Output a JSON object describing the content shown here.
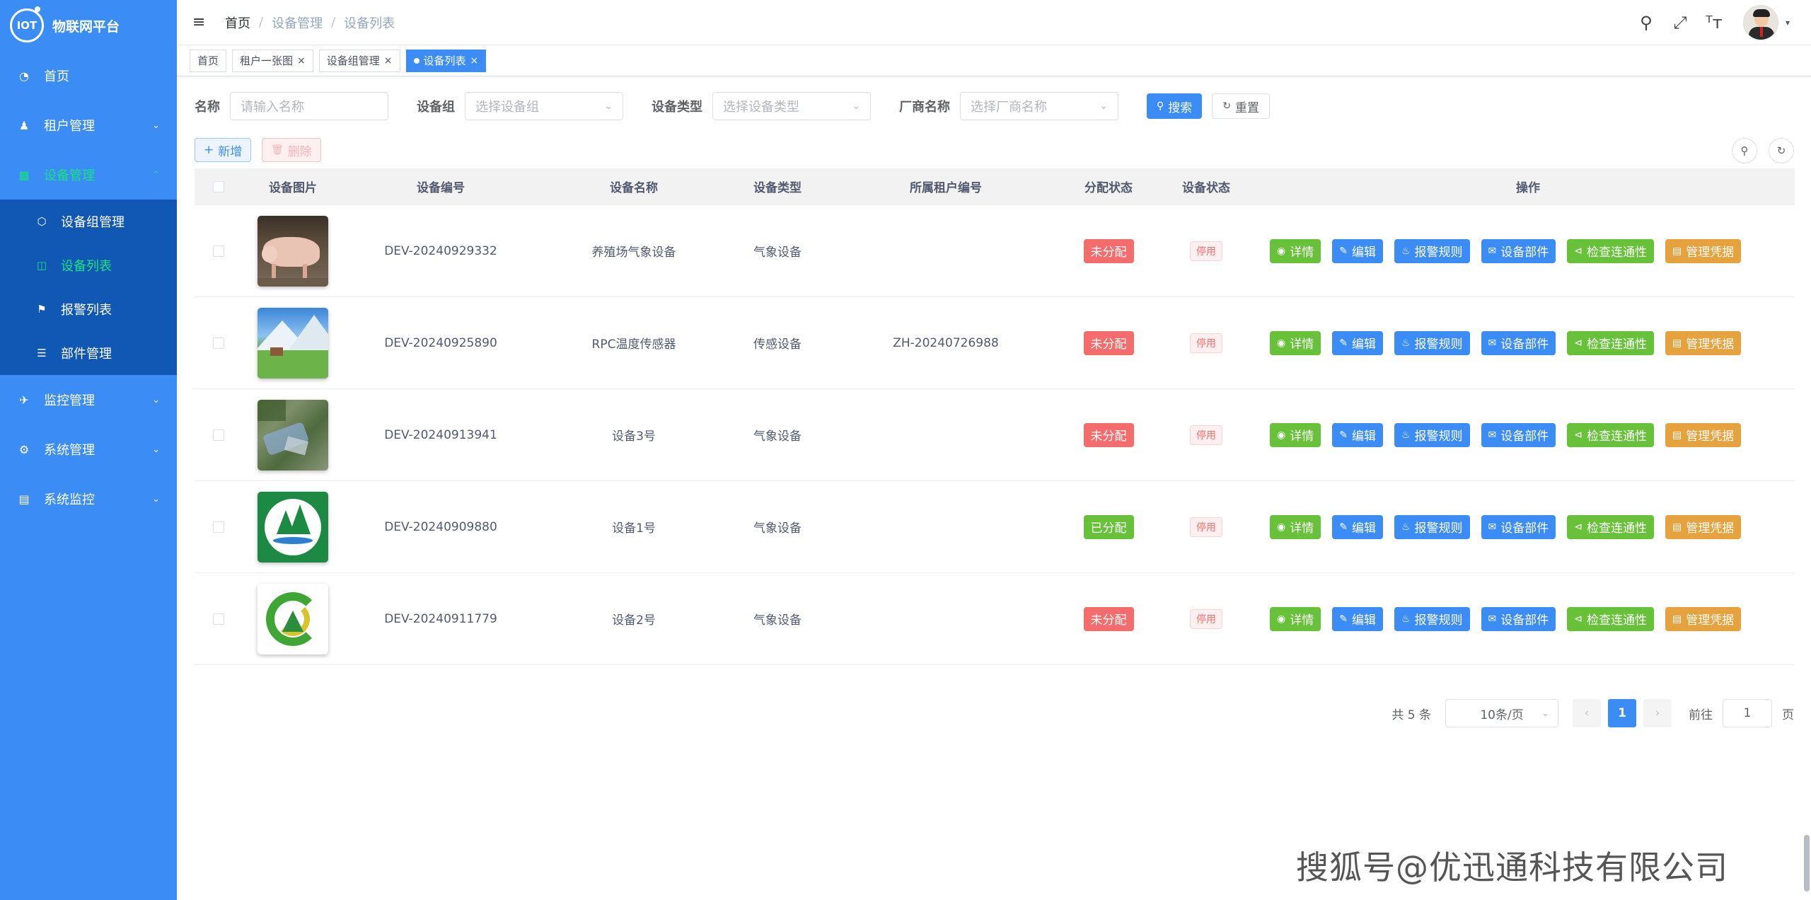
{
  "app": {
    "logo_text": "IOT",
    "title": "物联网平台"
  },
  "sidebar": {
    "items": [
      {
        "label": "首页",
        "icon": "dashboard-icon"
      },
      {
        "label": "租户管理",
        "icon": "user-icon"
      },
      {
        "label": "设备管理",
        "icon": "device-icon"
      },
      {
        "label": "监控管理",
        "icon": "monitor-icon"
      },
      {
        "label": "系统管理",
        "icon": "gear-icon"
      },
      {
        "label": "系统监控",
        "icon": "system-monitor-icon"
      }
    ],
    "sub_items": [
      {
        "label": "设备组管理",
        "icon": "cube-icon"
      },
      {
        "label": "设备列表",
        "icon": "screen-icon"
      },
      {
        "label": "报警列表",
        "icon": "alarm-icon"
      },
      {
        "label": "部件管理",
        "icon": "layers-icon"
      }
    ]
  },
  "header": {
    "breadcrumb": [
      "首页",
      "设备管理",
      "设备列表"
    ]
  },
  "tags": [
    {
      "label": "首页"
    },
    {
      "label": "租户一张图"
    },
    {
      "label": "设备组管理"
    },
    {
      "label": "设备列表"
    }
  ],
  "filters": {
    "name_label": "名称",
    "name_placeholder": "请输入名称",
    "group_label": "设备组",
    "group_placeholder": "选择设备组",
    "type_label": "设备类型",
    "type_placeholder": "选择设备类型",
    "vendor_label": "厂商名称",
    "vendor_placeholder": "选择厂商名称",
    "search_label": "搜索",
    "reset_label": "重置"
  },
  "toolbar": {
    "add_label": "新增",
    "delete_label": "删除"
  },
  "table": {
    "columns": [
      "设备图片",
      "设备编号",
      "设备名称",
      "设备类型",
      "所属租户编号",
      "分配状态",
      "设备状态",
      "操作"
    ],
    "rows": [
      {
        "code": "DEV-20240929332",
        "name": "养殖场气象设备",
        "type": "气象设备",
        "tenant": "",
        "assign": "未分配",
        "status": "停用"
      },
      {
        "code": "DEV-20240925890",
        "name": "RPC温度传感器",
        "type": "传感设备",
        "tenant": "ZH-20240726988",
        "assign": "未分配",
        "status": "停用"
      },
      {
        "code": "DEV-20240913941",
        "name": "设备3号",
        "type": "气象设备",
        "tenant": "",
        "assign": "未分配",
        "status": "停用"
      },
      {
        "code": "DEV-20240909880",
        "name": "设备1号",
        "type": "气象设备",
        "tenant": "",
        "assign": "已分配",
        "status": "停用"
      },
      {
        "code": "DEV-20240911779",
        "name": "设备2号",
        "type": "气象设备",
        "tenant": "",
        "assign": "未分配",
        "status": "停用"
      }
    ],
    "actions": [
      "详情",
      "编辑",
      "报警规则",
      "设备部件",
      "检查连通性",
      "管理凭据"
    ]
  },
  "pagination": {
    "total": "共 5 条",
    "page_size": "10条/页",
    "current": "1",
    "goto_label": "前往",
    "goto_value": "1",
    "page_suffix": "页"
  },
  "watermark": "搜狐号@优迅通科技有限公司",
  "colors": {
    "sidebar": "#3b8df5",
    "submenu": "#1157b4",
    "active": "#16e37f",
    "primary": "#3b8df5",
    "success": "#67c23a",
    "danger": "#f56c6c",
    "warning": "#e6a23c"
  }
}
